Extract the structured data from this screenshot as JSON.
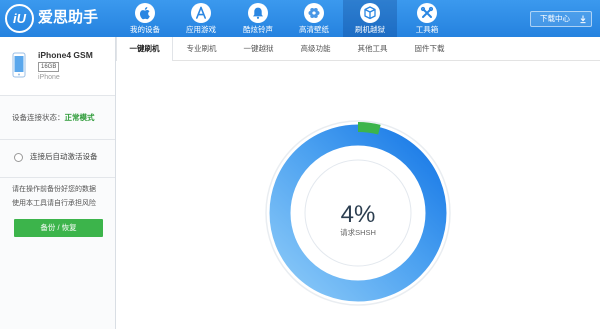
{
  "app": {
    "logo_text": "iU",
    "name": "爱思助手"
  },
  "nav": {
    "items": [
      {
        "label": "我的设备",
        "icon": "apple-icon"
      },
      {
        "label": "应用游戏",
        "icon": "app-store-icon"
      },
      {
        "label": "酷炫铃声",
        "icon": "bell-icon"
      },
      {
        "label": "高清壁纸",
        "icon": "wallpaper-icon"
      },
      {
        "label": "刷机越狱",
        "icon": "flash-jailbreak-icon",
        "active": true
      },
      {
        "label": "工具箱",
        "icon": "toolbox-icon"
      }
    ]
  },
  "download_center": {
    "label": "下载中心",
    "icon": "download-icon"
  },
  "device": {
    "model": "iPhone4 GSM",
    "capacity": "16GB",
    "type": "iPhone",
    "icon": "phone-icon"
  },
  "status": {
    "label": "设备连接状态：",
    "value": "正常模式",
    "value_color": "#2f9c3a"
  },
  "auto_activate": {
    "label": "连接后自动激活设备",
    "checked": false
  },
  "warning": {
    "line1": "请在操作前备份好您的数据",
    "line2": "使用本工具请自行承担风险"
  },
  "backup_button": {
    "label": "备份 / 恢复"
  },
  "tabs": {
    "active_index": 0,
    "items": [
      {
        "label": "一键刷机"
      },
      {
        "label": "专业刷机"
      },
      {
        "label": "一键越狱"
      },
      {
        "label": "高级功能"
      },
      {
        "label": "其他工具"
      },
      {
        "label": "固件下载"
      }
    ]
  },
  "progress": {
    "percent_text": "4%",
    "fraction": 0.04,
    "status_text": "请求SHSH"
  },
  "colors": {
    "header_blue": "#2b8ce8",
    "button_green": "#3cb44b",
    "ring_blue": "#1f80e8",
    "progress_green": "#3cb44b"
  }
}
